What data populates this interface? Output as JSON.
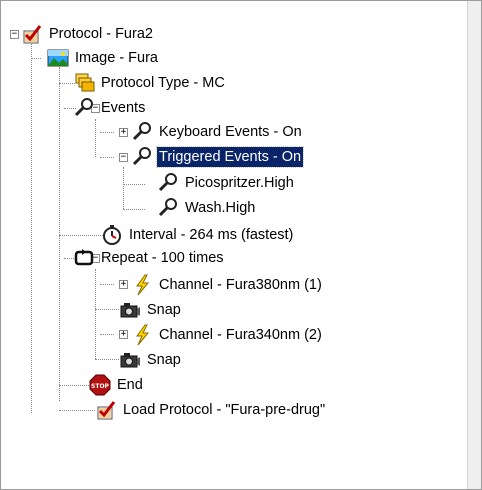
{
  "tree": {
    "root": {
      "label": "Protocol - Fura2",
      "icon": "protocol-check-icon",
      "children": {
        "image": {
          "label": "Image - Fura",
          "icon": "image-landscape-icon",
          "children": {
            "protocol_type": {
              "label": "Protocol Type - MC",
              "icon": "folder-stack-icon"
            },
            "events": {
              "label": "Events",
              "icon": "wrench-icon",
              "children": {
                "keyboard": {
                  "label": "Keyboard Events - On",
                  "icon": "wrench-icon"
                },
                "triggered": {
                  "label": "Triggered Events - On",
                  "icon": "wrench-icon",
                  "selected": true,
                  "children": {
                    "picospritzer": {
                      "label": "Picospritzer.High",
                      "icon": "wrench-icon"
                    },
                    "wash": {
                      "label": "Wash.High",
                      "icon": "wrench-icon"
                    }
                  }
                }
              }
            },
            "interval": {
              "label": "Interval - 264 ms (fastest)",
              "icon": "stopwatch-icon"
            },
            "repeat": {
              "label": "Repeat - 100 times",
              "icon": "repeat-loop-icon",
              "children": {
                "channel380": {
                  "label": "Channel - Fura380nm (1)",
                  "icon": "lightning-icon"
                },
                "snap1": {
                  "label": "Snap",
                  "icon": "camera-icon"
                },
                "channel340": {
                  "label": "Channel - Fura340nm (2)",
                  "icon": "lightning-icon"
                },
                "snap2": {
                  "label": "Snap",
                  "icon": "camera-icon"
                }
              }
            },
            "end": {
              "label": "End",
              "icon": "stop-sign-icon",
              "stop_text": "STOP"
            },
            "load_protocol": {
              "label": "Load Protocol - \"Fura-pre-drug\"",
              "icon": "protocol-check-icon"
            }
          }
        }
      }
    }
  },
  "colors": {
    "selection": "#0a246a",
    "lightning": "#ffd400",
    "stop": "#b01010"
  }
}
